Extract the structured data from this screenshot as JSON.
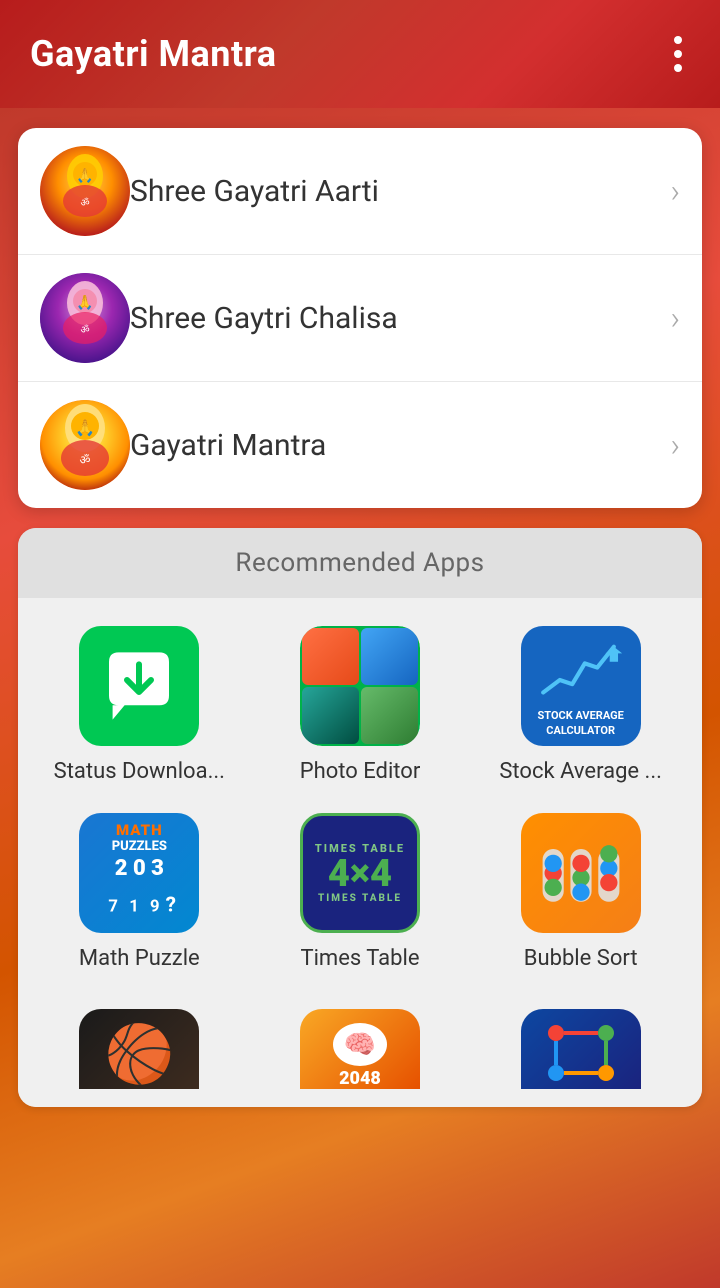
{
  "header": {
    "title": "Gayatri Mantra",
    "menu_icon_label": "menu"
  },
  "menu": {
    "items": [
      {
        "id": "aarti",
        "label": "Shree Gayatri Aarti",
        "icon": "🕉️"
      },
      {
        "id": "chalisa",
        "label": "Shree Gaytri Chalisa",
        "icon": "🪔"
      },
      {
        "id": "mantra",
        "label": "Gayatri Mantra",
        "icon": "🌸"
      }
    ]
  },
  "recommended": {
    "title": "Recommended Apps",
    "apps": [
      {
        "id": "status-downloader",
        "label": "Status Downloa...",
        "icon_type": "status"
      },
      {
        "id": "photo-editor",
        "label": "Photo Editor",
        "icon_type": "photo"
      },
      {
        "id": "stock-average",
        "label": "Stock Average ...",
        "icon_type": "stock"
      },
      {
        "id": "math-puzzle",
        "label": "Math Puzzle",
        "icon_type": "math"
      },
      {
        "id": "times-table",
        "label": "Times Table",
        "icon_type": "times"
      },
      {
        "id": "bubble-sort",
        "label": "Bubble Sort",
        "icon_type": "bubble"
      }
    ],
    "apps_partial": [
      {
        "id": "basketball",
        "label": "",
        "icon_type": "basket"
      },
      {
        "id": "2048",
        "label": "",
        "icon_type": "2048"
      },
      {
        "id": "connect-puzzle",
        "label": "",
        "icon_type": "connect"
      }
    ]
  }
}
